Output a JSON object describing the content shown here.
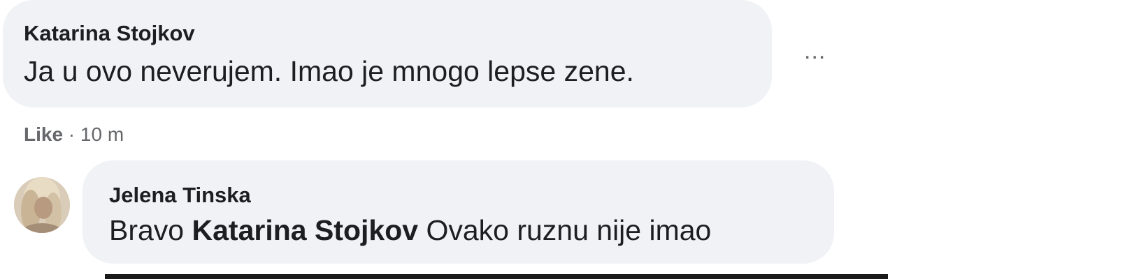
{
  "comment": {
    "author": "Katarina Stojkov",
    "text": "Ja u ovo neverujem. Imao je mnogo lepse zene.",
    "more_label": "...",
    "like_label": "Like",
    "separator": " · ",
    "time": "10 m"
  },
  "reply": {
    "author": "Jelena Tinska",
    "text_before": "Bravo ",
    "mention": "Katarina Stojkov",
    "text_after": " Ovako ruznu nije imao"
  }
}
